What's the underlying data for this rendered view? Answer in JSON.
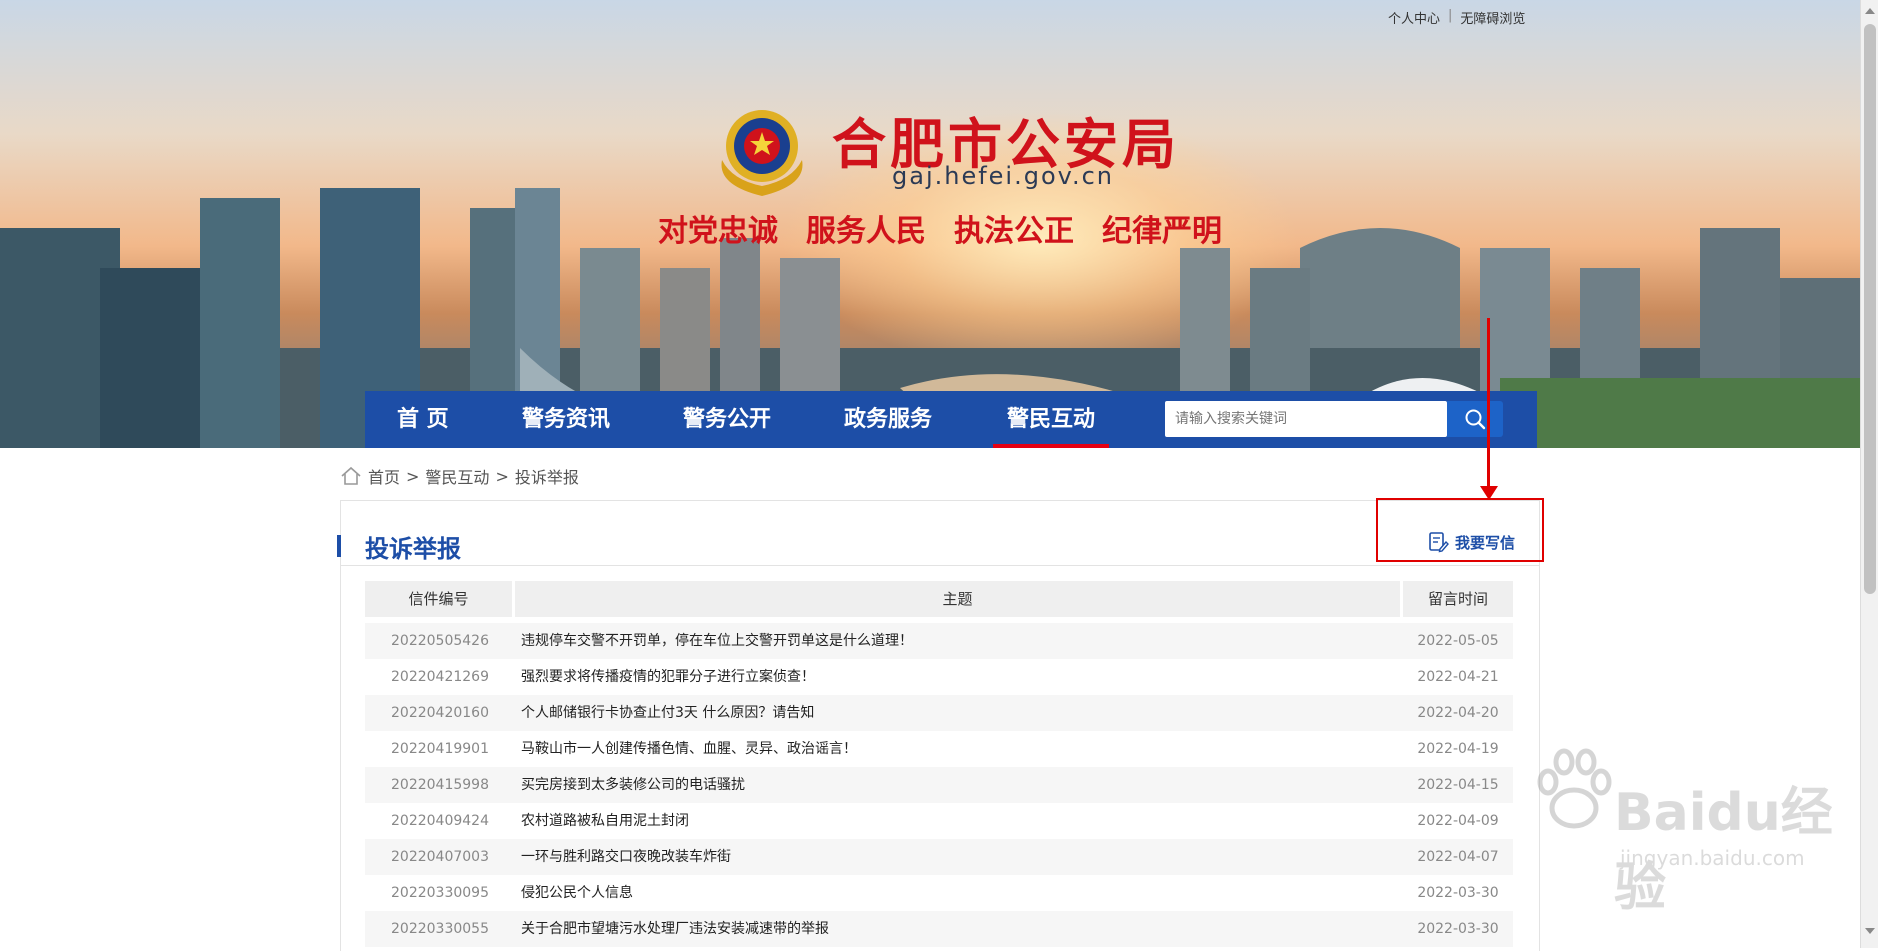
{
  "top_links": [
    "个人中心",
    "无障碍浏览"
  ],
  "site": {
    "title": "合肥市公安局",
    "domain": "gaj.hefei.gov.cn",
    "slogans": [
      "对党忠诚",
      "服务人民",
      "执法公正",
      "纪律严明"
    ]
  },
  "nav": {
    "items": [
      "首 页",
      "警务资讯",
      "警务公开",
      "政务服务",
      "警民互动"
    ],
    "active": "警民互动",
    "search_placeholder": "请输入搜索关键词"
  },
  "breadcrumb": [
    "首页",
    "警民互动",
    "投诉举报"
  ],
  "breadcrumb_sep": ">",
  "section": {
    "title": "投诉举报",
    "write_label": "我要写信"
  },
  "table": {
    "headers": [
      "信件编号",
      "主题",
      "留言时间"
    ],
    "rows": [
      {
        "id": "20220505426",
        "subject": "违规停车交警不开罚单，停在车位上交警开罚单这是什么道理！",
        "date": "2022-05-05"
      },
      {
        "id": "20220421269",
        "subject": "强烈要求将传播疫情的犯罪分子进行立案侦查！",
        "date": "2022-04-21"
      },
      {
        "id": "20220420160",
        "subject": "个人邮储银行卡协查止付3天 什么原因？请告知",
        "date": "2022-04-20"
      },
      {
        "id": "20220419901",
        "subject": "马鞍山市一人创建传播色情、血腥、灵异、政治谣言！",
        "date": "2022-04-19"
      },
      {
        "id": "20220415998",
        "subject": "买完房接到太多装修公司的电话骚扰",
        "date": "2022-04-15"
      },
      {
        "id": "20220409424",
        "subject": "农村道路被私自用泥土封闭",
        "date": "2022-04-09"
      },
      {
        "id": "20220407003",
        "subject": "一环与胜利路交口夜晚改装车炸街",
        "date": "2022-04-07"
      },
      {
        "id": "20220330095",
        "subject": "侵犯公民个人信息",
        "date": "2022-03-30"
      },
      {
        "id": "20220330055",
        "subject": "关于合肥市望塘污水处理厂违法安装减速带的举报",
        "date": "2022-03-30"
      }
    ]
  },
  "watermark": {
    "brand": "Baidu经验",
    "url": "jingyan.baidu.com"
  },
  "colors": {
    "nav_blue": "#1d4ea7",
    "brand_red": "#d0121b",
    "annotation_red": "#e00000"
  }
}
